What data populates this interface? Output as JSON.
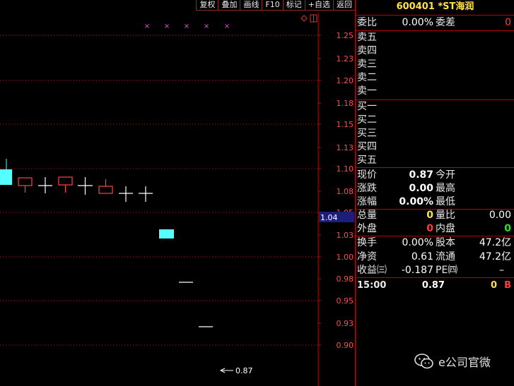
{
  "toolbar": [
    "复权",
    "叠加",
    "画线",
    "F10",
    "标记",
    "+自选",
    "返回"
  ],
  "chart": {
    "price_ticks": [
      "1.25",
      "1.23",
      "1.20",
      "1.18",
      "1.15",
      "1.13",
      "1.10",
      "1.08",
      "1.05",
      "1.03",
      "1.00",
      "0.98",
      "0.95",
      "0.93",
      "0.90"
    ],
    "current_price_tag": "1.04",
    "low_marker": "0.87"
  },
  "quote": {
    "title": "600401 *ST海润",
    "weibi_label": "委比",
    "weibi_value": "0.00%",
    "weicha_label": "委差",
    "weicha_value": "0",
    "sell_levels": [
      "卖五",
      "卖四",
      "卖三",
      "卖二",
      "卖一"
    ],
    "buy_levels": [
      "买一",
      "买二",
      "买三",
      "买四",
      "买五"
    ],
    "xianjia_label": "现价",
    "xianjia_value": "0.87",
    "jinkai_label": "今开",
    "zhangdie_label": "涨跌",
    "zhangdie_value": "0.00",
    "zuigao_label": "最高",
    "zhangfu_label": "涨幅",
    "zhangfu_value": "0.00%",
    "zuidi_label": "最低",
    "zongliang_label": "总量",
    "zongliang_value": "0",
    "liangbi_label": "量比",
    "liangbi_value": "0.00",
    "waipan_label": "外盘",
    "waipan_value": "0",
    "neipan_label": "内盘",
    "neipan_value": "0",
    "huanshou_label": "换手",
    "huanshou_value": "0.00%",
    "guben_label": "股本",
    "guben_value": "47.2亿",
    "jingzi_label": "净资",
    "jingzi_value": "0.61",
    "liutong_label": "流通",
    "liutong_value": "47.2亿",
    "shouyi_label": "收益㈢",
    "shouyi_value": "-0.187",
    "pe_label": "PE㈣",
    "pe_value": "–",
    "tick_time": "15:00",
    "tick_price": "0.87",
    "tick_vol": "0",
    "tick_side": "B"
  },
  "watermark": {
    "text": "e公司官微"
  }
}
